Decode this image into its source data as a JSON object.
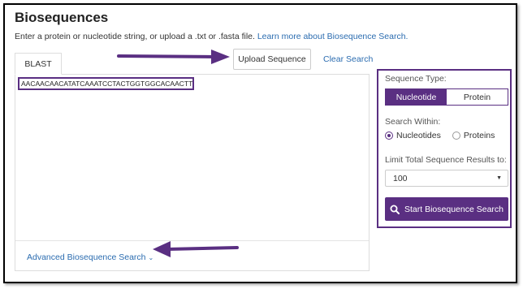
{
  "page": {
    "title": "Biosequences",
    "subtitle_text": "Enter a protein or nucleotide string, or upload a .txt or .fasta file.",
    "subtitle_link": "Learn more about Biosequence Search."
  },
  "tabs": [
    {
      "label": "BLAST",
      "active": true
    }
  ],
  "toolbar": {
    "upload_label": "Upload Sequence",
    "clear_label": "Clear Search"
  },
  "sequence": {
    "value": "AACAACAACATATCAAATCCTACTGGTGGCACAACTTGA"
  },
  "footer": {
    "advanced_label": "Advanced Biosequence Search"
  },
  "sidebar": {
    "sequence_type_label": "Sequence Type:",
    "sequence_types": [
      "Nucleotide",
      "Protein"
    ],
    "selected_sequence_type": "Nucleotide",
    "search_within_label": "Search Within:",
    "search_within_options": [
      "Nucleotides",
      "Proteins"
    ],
    "selected_search_within": "Nucleotides",
    "limit_label": "Limit Total Sequence Results to:",
    "limit_value": "100",
    "start_label": "Start Biosequence Search"
  },
  "colors": {
    "accent": "#5a2f82",
    "link": "#2b6cb0"
  },
  "icons": {
    "start_button": "search-icon",
    "dropdown": "caret-down-icon",
    "advanced": "chevron-down-icon",
    "annotations": "arrow-right-icon"
  }
}
